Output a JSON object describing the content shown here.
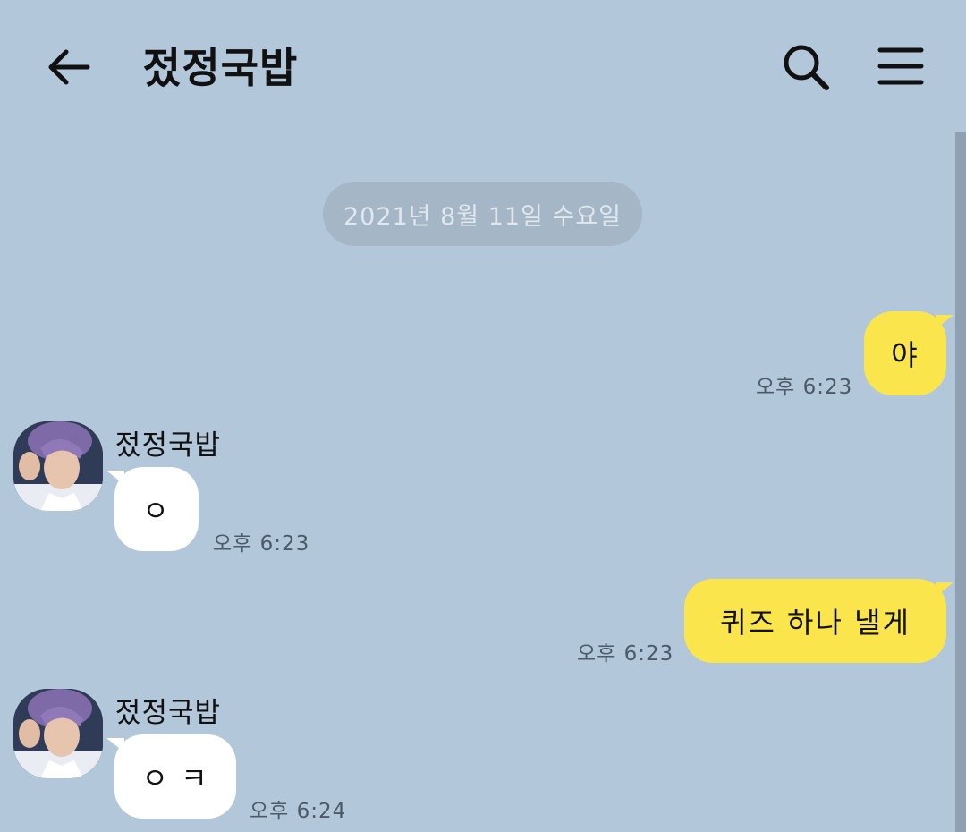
{
  "header": {
    "title": "젔정국밥",
    "back_icon": "back-arrow-icon",
    "search_icon": "search-icon",
    "menu_icon": "hamburger-menu-icon"
  },
  "date_divider": "2021년 8월 11일 수요일",
  "colors": {
    "background": "#b2c7da",
    "my_bubble": "#fbe54c",
    "their_bubble": "#ffffff",
    "date_pill": "#a5b6c6"
  },
  "messages": [
    {
      "from": "me",
      "text": "야",
      "time": "오후 6:23"
    },
    {
      "from": "other",
      "sender": "젔정국밥",
      "text": "ㅇ",
      "time": "오후 6:23"
    },
    {
      "from": "me",
      "text": "퀴즈 하나 낼게",
      "time": "오후 6:23"
    },
    {
      "from": "other",
      "sender": "젔정국밥",
      "text": "ㅇ ㅋ",
      "time": "오후 6:24"
    }
  ]
}
